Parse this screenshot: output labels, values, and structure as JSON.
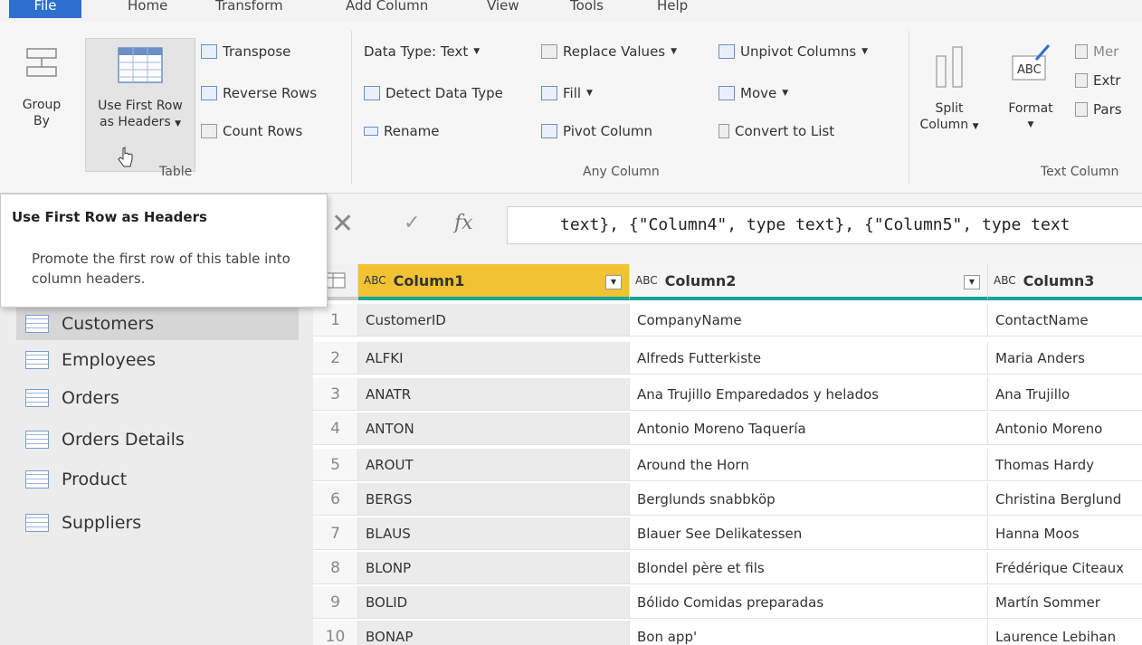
{
  "tabs": [
    "File",
    "Home",
    "Transform",
    "Add Column",
    "View",
    "Tools",
    "Help"
  ],
  "ribbon": {
    "group_by": [
      "Group",
      "By"
    ],
    "use_first_row": [
      "Use First Row",
      "as Headers"
    ],
    "transpose": "Transpose",
    "reverse_rows": "Reverse Rows",
    "count_rows": "Count Rows",
    "table_label": "Table",
    "data_type": "Data Type: Text",
    "detect_data_type": "Detect Data Type",
    "rename": "Rename",
    "replace_values": "Replace Values",
    "fill": "Fill",
    "pivot_column": "Pivot Column",
    "unpivot_columns": "Unpivot Columns",
    "move": "Move",
    "convert_to_list": "Convert to List",
    "any_column_label": "Any Column",
    "split_column": [
      "Split",
      "Column"
    ],
    "format": "Format",
    "merge": "Mer",
    "extract": "Extr",
    "parse": "Pars",
    "text_column_label": "Text Column"
  },
  "tooltip": {
    "title": "Use First Row as Headers",
    "description": "Promote the first row of this table into column headers."
  },
  "queries": [
    "Customers",
    "Employees",
    "Orders",
    "Orders Details",
    "Product",
    "Suppliers"
  ],
  "selected_query": "Customers",
  "formula_bar": {
    "cancel": "✕",
    "commit": "✓",
    "fx": "fx",
    "formula": "text}, {\"Column4\", type text}, {\"Column5\", type text"
  },
  "grid": {
    "type_icon": "ABC",
    "columns": [
      "Column1",
      "Column2",
      "Column3"
    ],
    "rows": [
      {
        "n": "1",
        "c1": "CustomerID",
        "c2": "CompanyName",
        "c3": "ContactName"
      },
      {
        "n": "2",
        "c1": "ALFKI",
        "c2": "Alfreds Futterkiste",
        "c3": "Maria Anders"
      },
      {
        "n": "3",
        "c1": "ANATR",
        "c2": "Ana Trujillo Emparedados y helados",
        "c3": "Ana Trujillo"
      },
      {
        "n": "4",
        "c1": "ANTON",
        "c2": "Antonio Moreno Taquería",
        "c3": "Antonio Moreno"
      },
      {
        "n": "5",
        "c1": "AROUT",
        "c2": "Around the Horn",
        "c3": "Thomas Hardy"
      },
      {
        "n": "6",
        "c1": "BERGS",
        "c2": "Berglunds snabbköp",
        "c3": "Christina Berglund"
      },
      {
        "n": "7",
        "c1": "BLAUS",
        "c2": "Blauer See Delikatessen",
        "c3": "Hanna Moos"
      },
      {
        "n": "8",
        "c1": "BLONP",
        "c2": "Blondel père et fils",
        "c3": "Frédérique Citeaux"
      },
      {
        "n": "9",
        "c1": "BOLID",
        "c2": "Bólido Comidas preparadas",
        "c3": "Martín Sommer"
      },
      {
        "n": "10",
        "c1": "BONAP",
        "c2": "Bon app'",
        "c3": "Laurence Lebihan"
      }
    ]
  },
  "colors": {
    "file_tab": "#2f6fcf",
    "selected_column_header": "#f1c232",
    "column_quality_bar": "#1aa39a"
  }
}
